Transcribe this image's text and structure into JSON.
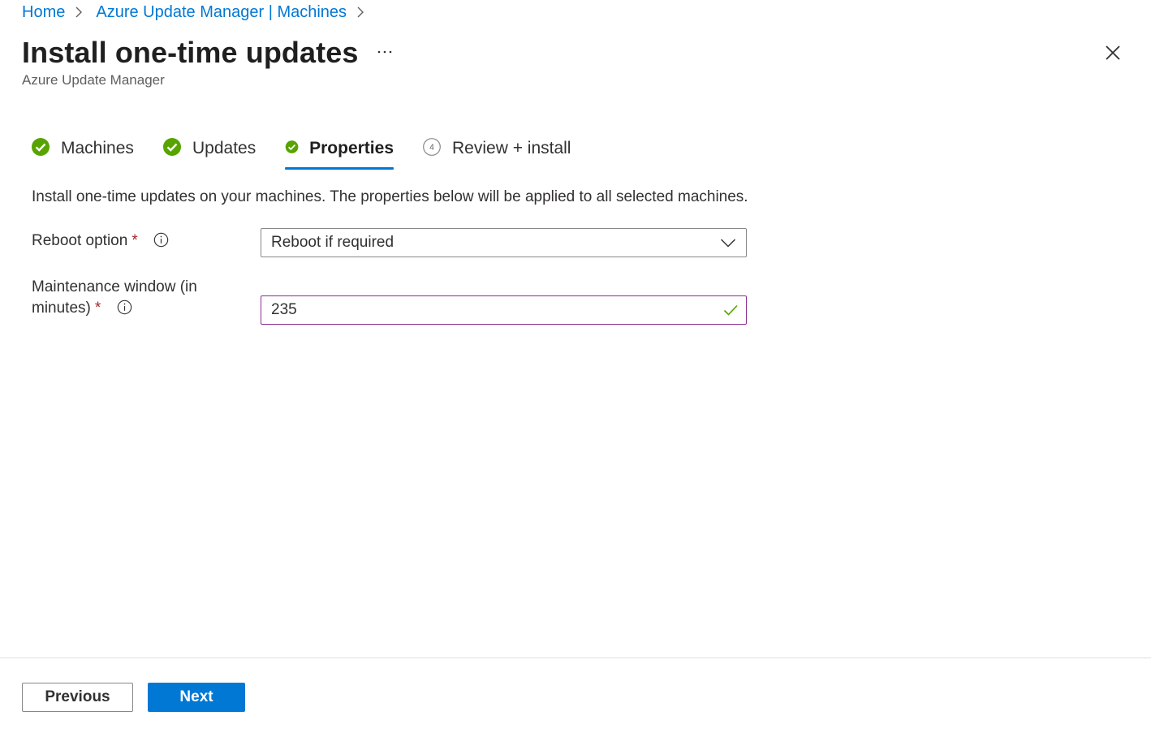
{
  "breadcrumb": {
    "items": [
      {
        "label": "Home"
      },
      {
        "label": "Azure Update Manager | Machines"
      }
    ]
  },
  "header": {
    "title": "Install one-time updates",
    "subtitle": "Azure Update Manager",
    "more_icon": "ellipsis-icon",
    "close_icon": "close-icon"
  },
  "tabs": [
    {
      "label": "Machines",
      "status": "complete"
    },
    {
      "label": "Updates",
      "status": "complete"
    },
    {
      "label": "Properties",
      "status": "complete",
      "active": true
    },
    {
      "label": "Review + install",
      "status": "pending",
      "step": "4"
    }
  ],
  "main": {
    "description": "Install one-time updates on your machines. The properties below will be applied to all selected machines.",
    "reboot": {
      "label": "Reboot option",
      "required_mark": "*",
      "value": "Reboot if required"
    },
    "maintenance": {
      "label_line1": "Maintenance window (in",
      "label_line2": "minutes)",
      "required_mark": "*",
      "value": "235"
    }
  },
  "footer": {
    "previous_label": "Previous",
    "next_label": "Next"
  },
  "colors": {
    "accent": "#0078d4",
    "success": "#57a300",
    "required": "#a4262c",
    "focus_border": "#8b2f8f"
  }
}
